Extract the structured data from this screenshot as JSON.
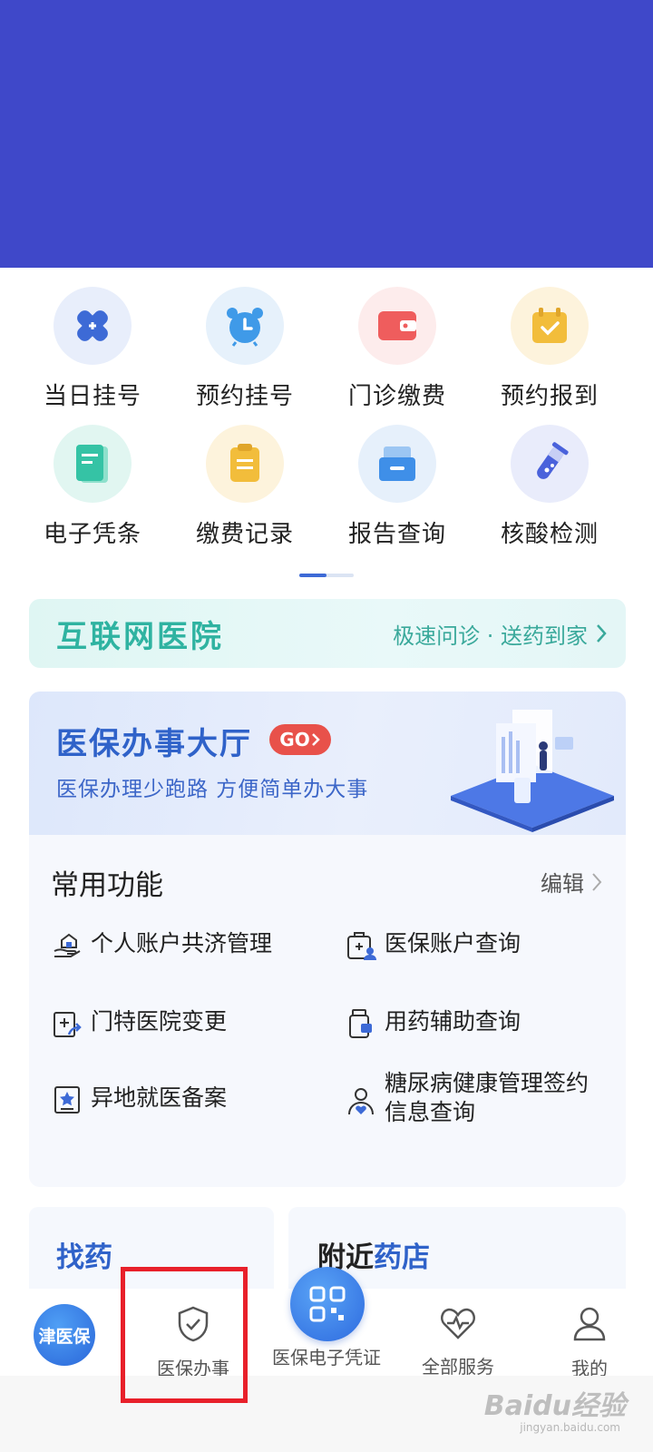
{
  "grid": [
    {
      "label": "当日挂号",
      "icon": "medical-cross-icon",
      "bg": "#e8eefb",
      "color": "#3d6ad6"
    },
    {
      "label": "预约挂号",
      "icon": "alarm-clock-icon",
      "bg": "#e6f1fb",
      "color": "#3f9ae8"
    },
    {
      "label": "门诊缴费",
      "icon": "wallet-icon",
      "bg": "#fdecec",
      "color": "#ef5d5d"
    },
    {
      "label": "预约报到",
      "icon": "calendar-check-icon",
      "bg": "#fdf3dc",
      "color": "#f2bd3b"
    },
    {
      "label": "电子凭条",
      "icon": "receipt-icon",
      "bg": "#e1f6f1",
      "color": "#35c3a5"
    },
    {
      "label": "缴费记录",
      "icon": "clipboard-icon",
      "bg": "#fdf3dc",
      "color": "#f2bd3b"
    },
    {
      "label": "报告查询",
      "icon": "report-tray-icon",
      "bg": "#e6f0fb",
      "color": "#3f8fe8"
    },
    {
      "label": "核酸检测",
      "icon": "test-tube-icon",
      "bg": "#e9ecfb",
      "color": "#4a62db"
    }
  ],
  "internet_hospital": {
    "title": "互联网医院",
    "subtitle": "极速问诊 · 送药到家"
  },
  "office_banner": {
    "title": "医保办事大厅",
    "go": "GO",
    "subtitle": "医保办理少跑路 方便简单办大事"
  },
  "common": {
    "title": "常用功能",
    "edit": "编辑",
    "items": [
      {
        "label": "个人账户共济管理",
        "icon": "hand-house-icon"
      },
      {
        "label": "医保账户查询",
        "icon": "medical-kit-user-icon"
      },
      {
        "label": "门特医院变更",
        "icon": "hospital-transfer-icon"
      },
      {
        "label": "用药辅助查询",
        "icon": "medicine-bottle-icon"
      },
      {
        "label": "异地就医备案",
        "icon": "star-document-icon"
      },
      {
        "label": "糖尿病健康管理签约信息查询",
        "icon": "person-heart-icon"
      }
    ]
  },
  "cards": {
    "find": "找药",
    "pharmacy_a": "附近",
    "pharmacy_b": "药店"
  },
  "tabbar": {
    "logo": "津医保",
    "office": "医保办事",
    "voucher": "医保电子凭证",
    "services": "全部服务",
    "mine": "我的"
  },
  "watermark": {
    "main": "Baidu经验",
    "sub": "jingyan.baidu.com"
  },
  "colors": {
    "banner": "#3f48c9",
    "accent": "#2f62c9",
    "highlight": "#e8202a"
  }
}
